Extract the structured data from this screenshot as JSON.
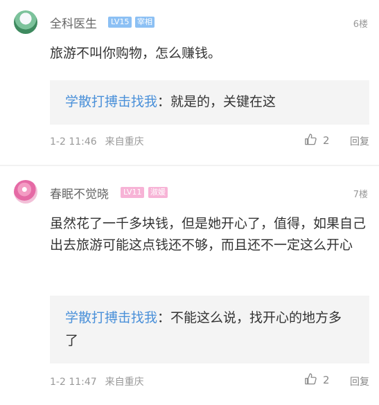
{
  "comments": [
    {
      "username": "全科医生",
      "level": "LV15",
      "title": "宰相",
      "floor": "6楼",
      "text": "旅游不叫你购物，怎么赚钱。",
      "reply": {
        "author": "学散打搏击找我",
        "separator": "：",
        "text": "就是的，关键在这"
      },
      "time": "1-2 11:46",
      "location": "来自重庆",
      "likes": "2",
      "reply_label": "回复",
      "icons": {
        "avatar": "avatar-landscape",
        "like": "thumbs-up-icon"
      }
    },
    {
      "username": "春眠不觉晓",
      "level": "LV11",
      "title": "淑媛",
      "floor": "7楼",
      "text": "虽然花了一千多块钱，但是她开心了，值得，如果自己出去旅游可能这点钱还不够，而且还不一定这么开心",
      "reply": {
        "author": "学散打搏击找我",
        "separator": "：",
        "text": "不能这么说，找开心的地方多了"
      },
      "time": "1-2 11:47",
      "location": "来自重庆",
      "likes": "2",
      "reply_label": "回复",
      "icons": {
        "avatar": "avatar-flowers",
        "like": "thumbs-up-icon"
      }
    }
  ],
  "colors": {
    "link": "#4a90d9",
    "badge_blue": "#8cc0f4",
    "badge_pink": "#f7b3d6",
    "reply_bg": "#f4f4f4"
  }
}
